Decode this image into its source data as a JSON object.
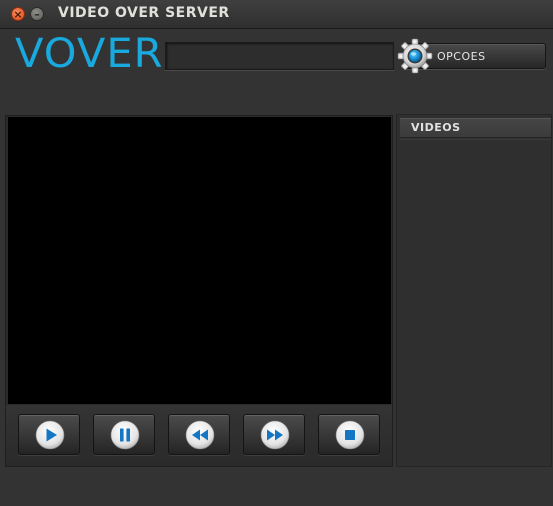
{
  "window": {
    "title": "VIDEO OVER SERVER",
    "close_glyph": "×",
    "minimize_glyph": "–"
  },
  "header": {
    "logo": "VOVER",
    "url_input": {
      "value": "",
      "placeholder": ""
    },
    "options_button": {
      "label": "OPCOES",
      "icon": "gear-icon"
    }
  },
  "player": {
    "controls": [
      {
        "name": "play-button",
        "icon": "play-icon"
      },
      {
        "name": "pause-button",
        "icon": "pause-icon"
      },
      {
        "name": "rewind-button",
        "icon": "rewind-icon"
      },
      {
        "name": "fast-forward-button",
        "icon": "fast-forward-icon"
      },
      {
        "name": "stop-button",
        "icon": "stop-icon"
      }
    ]
  },
  "videos_panel": {
    "title": "VIDEOS",
    "items": []
  },
  "colors": {
    "accent": "#19a9de",
    "background": "#333333",
    "video_area": "#000000",
    "close_button": "#df4b16"
  }
}
